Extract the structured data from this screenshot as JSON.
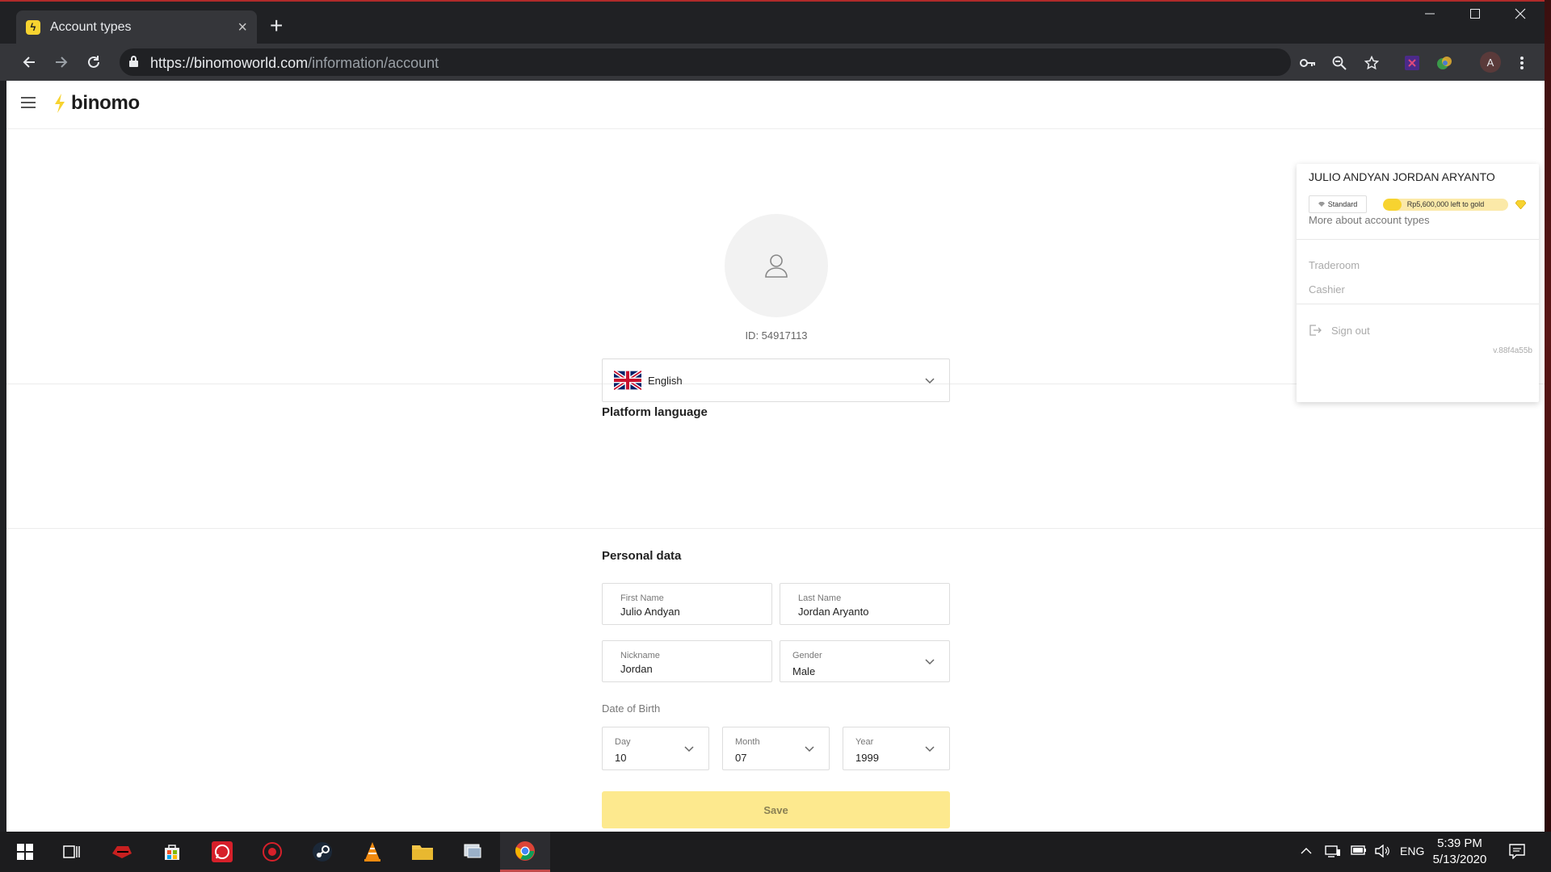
{
  "browser": {
    "tab_title": "Account types",
    "tab_close": "×",
    "new_tab": "+",
    "url_host": "https://binomoworld.com",
    "url_path": "/information/account",
    "profile_initial": "A"
  },
  "site": {
    "logo_text": "binomo",
    "brand_color": "#f7d330"
  },
  "profile": {
    "user_id": "ID: 54917113"
  },
  "language_section": {
    "title": "Platform language",
    "selected": "English"
  },
  "personal_section": {
    "title": "Personal data",
    "first_name_label": "First Name",
    "first_name_value": "Julio Andyan",
    "last_name_label": "Last Name",
    "last_name_value": "Jordan Aryanto",
    "nickname_label": "Nickname",
    "nickname_value": "Jordan",
    "gender_label": "Gender",
    "gender_value": "Male",
    "dob_label": "Date of Birth",
    "day_label": "Day",
    "day_value": "10",
    "month_label": "Month",
    "month_value": "07",
    "year_label": "Year",
    "year_value": "1999",
    "save_label": "Save"
  },
  "dropdown": {
    "name": "JULIO ANDYAN JORDAN ARYANTO",
    "account_type": "Standard",
    "progress_text": "Rp5,600,000 left to gold",
    "progress_fraction": 0.15,
    "more_link": "More about account types",
    "traderoom": "Traderoom",
    "cashier": "Cashier",
    "sign_out": "Sign out",
    "version": "v.88f4a55b"
  },
  "taskbar": {
    "language": "ENG",
    "time": "5:39 PM",
    "date": "5/13/2020"
  }
}
